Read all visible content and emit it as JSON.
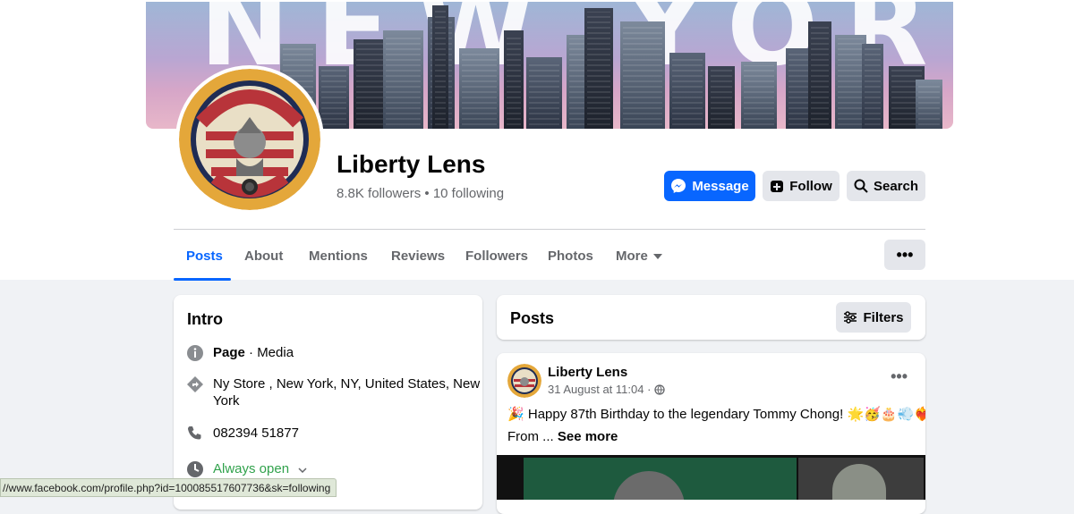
{
  "cover": {
    "title": "NEW YORK",
    "colors": {
      "sky_top": "#9fb6d6",
      "sky_bottom": "#e8b7c9"
    }
  },
  "page": {
    "name": "Liberty Lens",
    "followers_text": "8.8K followers",
    "following_text": "10 following",
    "separator": "•",
    "logo_icon": "liberty-lens-logo"
  },
  "actions": {
    "message": "Message",
    "follow": "Follow",
    "search": "Search"
  },
  "tabs": [
    {
      "label": "Posts",
      "active": true
    },
    {
      "label": "About"
    },
    {
      "label": "Mentions"
    },
    {
      "label": "Reviews"
    },
    {
      "label": "Followers"
    },
    {
      "label": "Photos"
    },
    {
      "label": "More"
    }
  ],
  "tabs_more_icon": "•••",
  "intro": {
    "title": "Intro",
    "category_bold": "Page",
    "category_rest": " · Media",
    "address_line1": "Ny Store , New York, NY, United States, New",
    "address_line2": "York",
    "phone": "082394 51877",
    "hours": "Always open"
  },
  "posts_header": {
    "title": "Posts",
    "filters": "Filters"
  },
  "post": {
    "author": "Liberty Lens",
    "time": "31 August at 11:04 ·",
    "menu_icon": "•••",
    "text_line1": "Happy 87th Birthday to the legendary Tommy Chong!",
    "emoji_lead": "🎉",
    "emoji_tail": "🌟🥳🎂💨❤️‍🔥",
    "text_line2_prefix": "From ...",
    "see_more": "See more"
  },
  "status_bar": {
    "url": "//www.facebook.com/profile.php?id=100085517607736&sk=following"
  },
  "colors": {
    "accent": "#0866ff",
    "secondary_text": "#65676b",
    "open_green": "#31a24c"
  }
}
